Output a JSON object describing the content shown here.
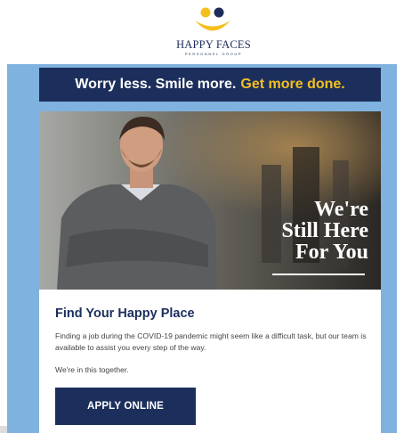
{
  "logo": {
    "name": "HAPPY FACES",
    "subtitle": "PERSONNEL GROUP",
    "colors": {
      "eyes": "#1c2b5a",
      "smile": "#f4c020",
      "text": "#1c2b5a"
    }
  },
  "banner": {
    "text_main": "Worry less. Smile more.",
    "text_accent": "Get more done.",
    "background": "#1c2f5c",
    "accent_color": "#f4c020"
  },
  "hero": {
    "image": "photo-man-arms-crossed-in-workshop",
    "lines": [
      "We're",
      "Still Here",
      "For You"
    ]
  },
  "card": {
    "title": "Find Your Happy Place",
    "body": "Finding a job during the COVID-19 pandemic might seem like a difficult task, but our team is available to assist you every step of the way.",
    "note": "We're in this together.",
    "button_label": "APPLY ONLINE"
  },
  "colors": {
    "frame": "#7fb2df",
    "navy": "#1c2f5c"
  }
}
